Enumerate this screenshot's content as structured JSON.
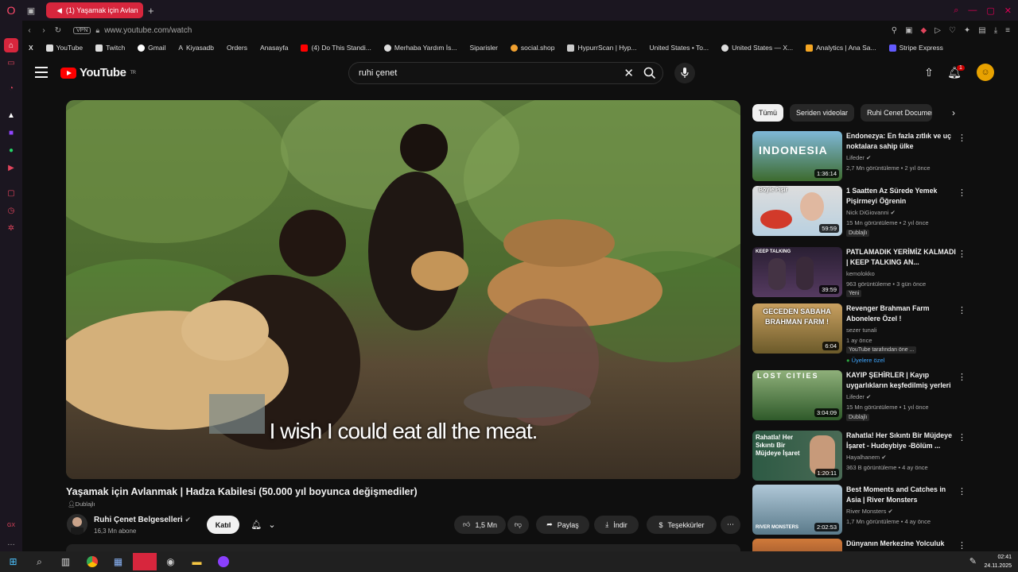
{
  "browser": {
    "tab_title": "(1) Yaşamak için Avlan",
    "url": "www.youtube.com/watch",
    "vpn_label": "VPN",
    "bookmarks": [
      {
        "label": "YouTube"
      },
      {
        "label": "Twitch"
      },
      {
        "label": "Gmail"
      },
      {
        "label": "Kiyasadb"
      },
      {
        "label": "Orders"
      },
      {
        "label": "Anasayfa"
      },
      {
        "label": "(4) Do This Standi..."
      },
      {
        "label": "Merhaba Yardım İs..."
      },
      {
        "label": "Siparisler"
      },
      {
        "label": "social.shop"
      },
      {
        "label": "HypurrScan | Hyp..."
      },
      {
        "label": "United States • To..."
      },
      {
        "label": "United States — X..."
      },
      {
        "label": "Analytics | Ana Sa..."
      },
      {
        "label": "Stripe Express"
      }
    ]
  },
  "header": {
    "logo_text": "YouTube",
    "logo_region": "TR",
    "search_query": "ruhi çenet",
    "notification_count": "1"
  },
  "video": {
    "subtitle": "I wish I could eat all the meat.",
    "title": "Yaşamak için Avlanmak | Hadza Kabilesi (50.000 yıl boyunca değişmediler)",
    "dub_label": "Dublajlı",
    "channel_name": "Ruhi Çenet Belgeselleri",
    "subscribers": "16,3 Mn abone",
    "join_label": "Katıl",
    "like_count": "1,5 Mn",
    "share_label": "Paylaş",
    "download_label": "İndir",
    "thanks_label": "Teşekkürler"
  },
  "chips": [
    "Tümü",
    "Seriden videolar",
    "Ruhi Cenet Documen"
  ],
  "recommendations": [
    {
      "title": "Endonezya: En fazla zıtlık ve uç noktalara sahip ülke",
      "channel": "Lifeder",
      "meta": "2,7 Mn görüntüleme • 2 yıl önce",
      "duration": "1:36:14",
      "badges": [],
      "thumb_text": "INDONESIA"
    },
    {
      "title": "1 Saatten Az Sürede Yemek Pişirmeyi Öğrenin",
      "channel": "Nick DiGiovanni",
      "meta": "15 Mn görüntüleme • 2 yıl önce",
      "duration": "59:59",
      "badges": [
        "Dublajlı"
      ],
      "thumb_text": "Böyle Pişir"
    },
    {
      "title": "PATLAMADIK YERİMİZ KALMADI | KEEP TALKING AN...",
      "channel": "kemolokko",
      "meta": "963 görüntüleme • 3 gün önce",
      "duration": "39:59",
      "badges": [
        "Yeni"
      ],
      "thumb_text": "KEEP TALKING"
    },
    {
      "title": "Revenger Brahman Farm Abonelere Özel !",
      "channel": "sezer tunali",
      "meta": "1 ay önce",
      "duration": "6:04",
      "badges": [
        "YouTube tarafından öne ...",
        "Üyelere özel"
      ],
      "thumb_text": "GECEDEN SABAHA BRAHMAN FARM !"
    },
    {
      "title": "KAYIP ŞEHİRLER | Kayıp uygarlıkların keşfedilmiş yerleri",
      "channel": "Lifeder",
      "meta": "15 Mn görüntüleme • 1 yıl önce",
      "duration": "3:04:09",
      "badges": [
        "Dublajlı"
      ],
      "thumb_text": "LOST CITIES"
    },
    {
      "title": "Rahatla! Her Sıkıntı Bir Müjdeye İşaret - Hudeybiye -Bölüm ...",
      "channel": "Hayalhanem",
      "meta": "363 B görüntüleme • 4 ay önce",
      "duration": "1:20:11",
      "badges": [],
      "thumb_text": "Rahatla! Her Sıkıntı Bir Müjdeye İşaret"
    },
    {
      "title": "Best Moments and Catches in Asia | River Monsters",
      "channel": "River Monsters",
      "meta": "1,7 Mn görüntüleme • 4 ay önce",
      "duration": "2:02:53",
      "badges": [],
      "thumb_text": "RIVER MONSTERS"
    },
    {
      "title": "Dünyanın Merkezine Yolculuk",
      "channel": "",
      "meta": "",
      "duration": "",
      "badges": [],
      "thumb_text": ""
    }
  ],
  "taskbar": {
    "time": "02:41",
    "date": "24.11.2025"
  },
  "colors": {
    "background": "#0f0f0f",
    "youtube_red": "#ff0000",
    "opera_red": "#d7263d",
    "chip_bg": "#272727"
  }
}
